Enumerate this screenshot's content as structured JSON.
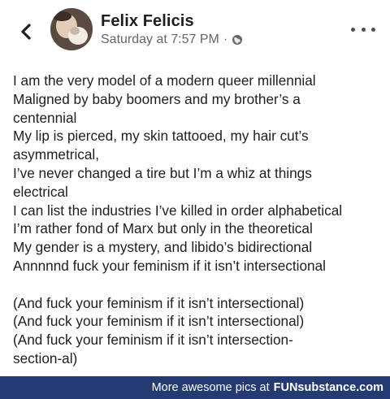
{
  "header": {
    "back_icon": "chevron-left-icon",
    "author": "Felix Felicis",
    "timestamp": "Saturday at 7:57 PM",
    "separator": "·",
    "privacy_icon": "globe-icon",
    "more_icon": "more-dots-icon"
  },
  "post": {
    "lines": [
      "I am the very model of a modern queer millennial",
      "Maligned by baby boomers and my brother’s a",
      "centennial",
      "My lip is pierced, my skin tattooed, my hair cut’s",
      "asymmetrical,",
      "I’ve never changed a tire but I’m a whiz at things",
      "electrical",
      "I can list the industries I’ve killed in order alphabetical",
      "I’m rather fond of Marx but only in the theoretical",
      "My gender is a mystery, and libido’s bidirectional",
      "Annnnnd fuck your feminism if it isn’t intersectional",
      "",
      "(And fuck your feminism if it isn’t intersectional)",
      "(And fuck your feminism if it isn’t intersectional)",
      "(And fuck your feminism if it isn’t intersection-",
      "section-al)"
    ]
  },
  "footer": {
    "text": "More awesome pics at",
    "brand": "FUNsubstance.com"
  }
}
